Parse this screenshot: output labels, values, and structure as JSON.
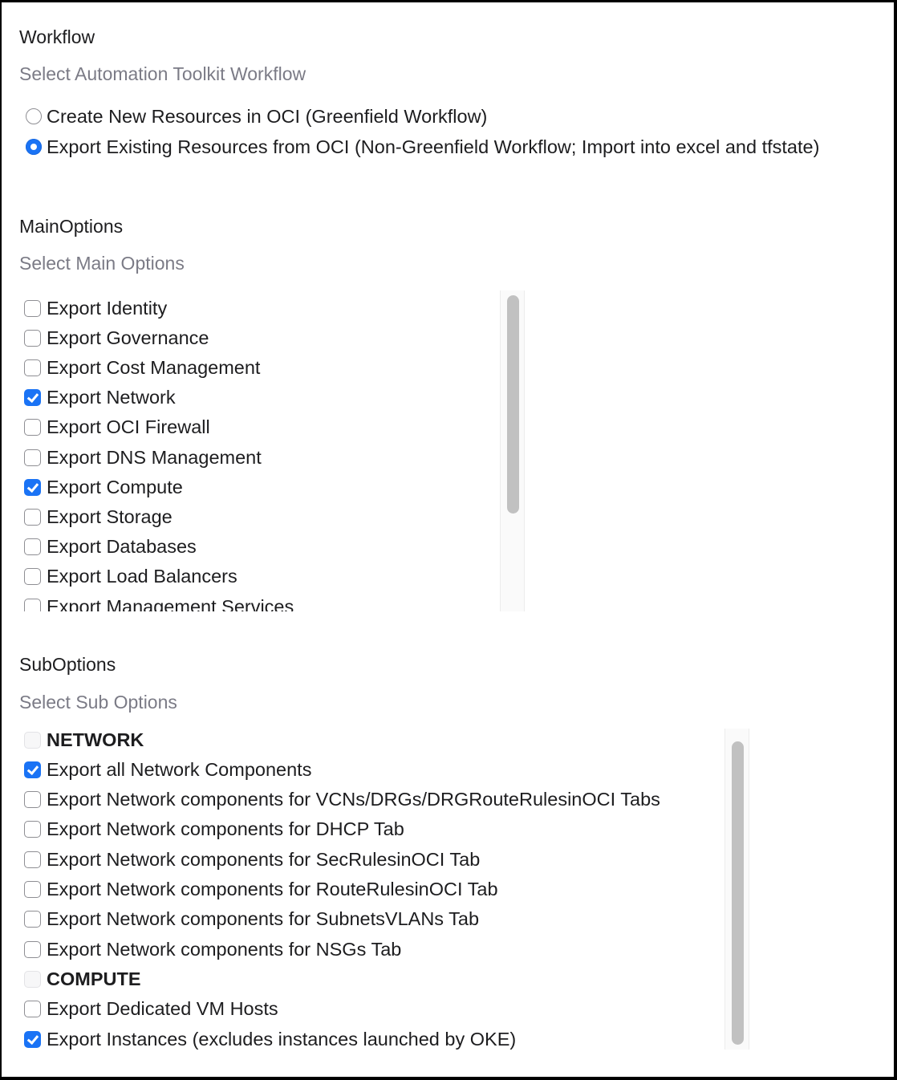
{
  "workflow": {
    "title": "Workflow",
    "subtitle": "Select Automation Toolkit Workflow",
    "options": [
      {
        "label": "Create New Resources in OCI (Greenfield Workflow)",
        "selected": false
      },
      {
        "label": "Export Existing Resources from OCI (Non-Greenfield Workflow; Import into excel and tfstate)",
        "selected": true
      }
    ]
  },
  "main_options": {
    "title": "MainOptions",
    "subtitle": "Select Main Options",
    "items": [
      {
        "label": "Export Identity",
        "checked": false
      },
      {
        "label": "Export Governance",
        "checked": false
      },
      {
        "label": "Export Cost Management",
        "checked": false
      },
      {
        "label": "Export Network",
        "checked": true
      },
      {
        "label": "Export OCI Firewall",
        "checked": false
      },
      {
        "label": "Export DNS Management",
        "checked": false
      },
      {
        "label": "Export Compute",
        "checked": true
      },
      {
        "label": "Export Storage",
        "checked": false
      },
      {
        "label": "Export Databases",
        "checked": false
      },
      {
        "label": "Export Load Balancers",
        "checked": false
      },
      {
        "label": "Export Management Services",
        "checked": false
      }
    ],
    "scroll_position": 0.0
  },
  "sub_options": {
    "title": "SubOptions",
    "subtitle": "Select Sub Options",
    "items": [
      {
        "label": "NETWORK",
        "checked": false,
        "group": true
      },
      {
        "label": "Export all Network Components",
        "checked": true,
        "group": false
      },
      {
        "label": "Export Network components for VCNs/DRGs/DRGRouteRulesinOCI Tabs",
        "checked": false,
        "group": false
      },
      {
        "label": "Export Network components for DHCP Tab",
        "checked": false,
        "group": false
      },
      {
        "label": "Export Network components for SecRulesinOCI Tab",
        "checked": false,
        "group": false
      },
      {
        "label": "Export Network components for RouteRulesinOCI Tab",
        "checked": false,
        "group": false
      },
      {
        "label": "Export Network components for SubnetsVLANs Tab",
        "checked": false,
        "group": false
      },
      {
        "label": "Export Network components for NSGs Tab",
        "checked": false,
        "group": false
      },
      {
        "label": "COMPUTE",
        "checked": false,
        "group": true
      },
      {
        "label": "Export Dedicated VM Hosts",
        "checked": false,
        "group": false
      },
      {
        "label": "Export Instances (excludes instances launched by OKE)",
        "checked": true,
        "group": false
      }
    ],
    "scroll_position": 0.0
  },
  "colors": {
    "accent": "#1a73f5",
    "subtitle_text": "#7b7b86",
    "scroll_thumb": "#c1c1c1"
  }
}
